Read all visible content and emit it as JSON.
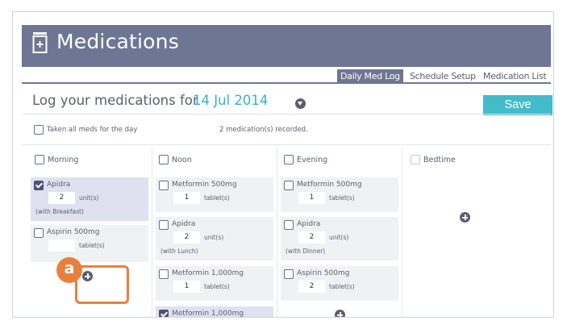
{
  "header": {
    "title": "Medications",
    "icon": "pill-bottle-icon"
  },
  "tabs": [
    {
      "label": "Daily Med Log",
      "active": true
    },
    {
      "label": "Schedule Setup",
      "active": false
    },
    {
      "label": "Medication List",
      "active": false
    }
  ],
  "log": {
    "prefix": "Log your medications for",
    "date": "14 Jul 2014",
    "save_label": "Save"
  },
  "summary": {
    "all_meds_label": "Taken all meds for the day",
    "recorded_text": "2 medication(s) recorded."
  },
  "columns": [
    {
      "name": "Morning",
      "meds": [
        {
          "name": "Apidra",
          "dose": "2",
          "unit": "unit(s)",
          "note": "(with Breakfast)",
          "checked": true
        },
        {
          "name": "Aspirin 500mg",
          "dose": "",
          "unit": "tablet(s)",
          "note": "",
          "checked": false
        }
      ]
    },
    {
      "name": "Noon",
      "meds": [
        {
          "name": "Metformin 500mg",
          "dose": "1",
          "unit": "tablet(s)",
          "note": "",
          "checked": false
        },
        {
          "name": "Apidra",
          "dose": "2",
          "unit": "unit(s)",
          "note": "(with Lunch)",
          "checked": false
        },
        {
          "name": "Metformin 1,000mg",
          "dose": "1",
          "unit": "tablet(s)",
          "note": "",
          "checked": false
        },
        {
          "name": "Metformin 1,000mg",
          "dose": "",
          "unit": "",
          "note": "",
          "checked": true
        }
      ]
    },
    {
      "name": "Evening",
      "meds": [
        {
          "name": "Metformin 500mg",
          "dose": "1",
          "unit": "tablet(s)",
          "note": "",
          "checked": false
        },
        {
          "name": "Apidra",
          "dose": "2",
          "unit": "unit(s)",
          "note": "(with Dinner)",
          "checked": false
        },
        {
          "name": "Aspirin 500mg",
          "dose": "2",
          "unit": "tablet(s)",
          "note": "",
          "checked": false
        }
      ]
    },
    {
      "name": "Bedtime",
      "meds": []
    }
  ],
  "callout": {
    "label": "a"
  },
  "colors": {
    "header": "#6f7693",
    "accent": "#3ab0c3",
    "save": "#42bcc9",
    "callout": "#e8803d",
    "selected_card": "#dfe1f1"
  }
}
